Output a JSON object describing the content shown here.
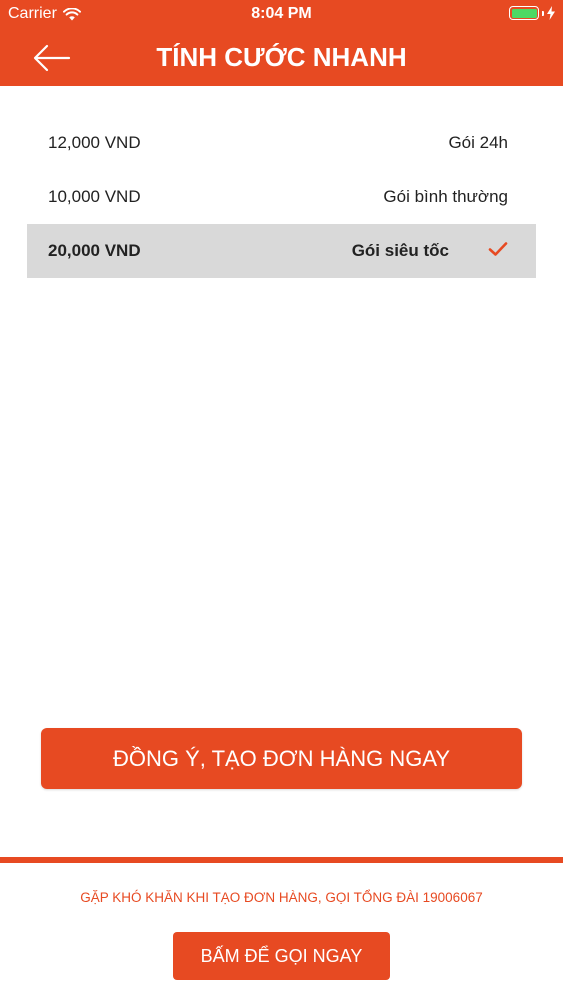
{
  "status_bar": {
    "carrier": "Carrier",
    "time": "8:04 PM",
    "wifi_icon": "wifi-icon",
    "battery_icon": "battery-icon",
    "charging_icon": "bolt-icon"
  },
  "nav": {
    "title": "TÍNH CƯỚC NHANH",
    "back_icon": "arrow-left-icon"
  },
  "prices": [
    {
      "amount": "12,000 VND",
      "package": "Gói 24h",
      "selected": false
    },
    {
      "amount": "10,000 VND",
      "package": "Gói bình thường",
      "selected": false
    },
    {
      "amount": "20,000 VND",
      "package": "Gói siêu tốc",
      "selected": true
    }
  ],
  "confirm_button": {
    "label": "ĐỒNG Ý, TẠO ĐƠN HÀNG NGAY"
  },
  "help": {
    "text": "GẶP KHÓ KHĂN KHI TẠO ĐƠN HÀNG, GỌI TỔNG ĐÀI 19006067"
  },
  "call_button": {
    "label": "BẤM ĐỂ GỌI NGAY"
  },
  "colors": {
    "accent": "#e74a22",
    "selected_row_bg": "#d9d9d9",
    "battery_fill": "#4cd964"
  }
}
